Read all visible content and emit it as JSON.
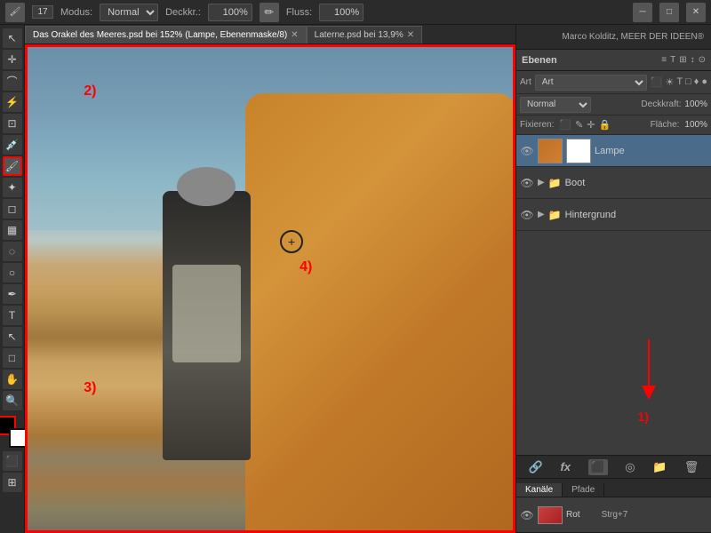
{
  "topbar": {
    "brush_size": "17",
    "modus_label": "Modus:",
    "modus_value": "Normal",
    "deckraft_label": "Deckkr.:",
    "deckraft_value": "100%",
    "fluss_label": "Fluss:",
    "fluss_value": "100%"
  },
  "tabs": [
    {
      "label": "Das Orakel des Meeres.psd bei 152% (Lampe, Ebenenmaske/8)",
      "active": true
    },
    {
      "label": "Laterne.psd bei 13,9%",
      "active": false
    }
  ],
  "layers_panel": {
    "title": "Ebenen",
    "filter_label": "Art",
    "blend_mode": "Normal",
    "opacity_label": "Deckkraft:",
    "opacity_value": "100%",
    "fix_label": "Fixieren:",
    "fill_label": "Fläche:",
    "fill_value": "100%",
    "layers": [
      {
        "name": "Lampe",
        "type": "layer_with_mask",
        "eye": true,
        "active": true
      },
      {
        "name": "Boot",
        "type": "folder",
        "eye": true,
        "active": false
      },
      {
        "name": "Hintergrund",
        "type": "folder",
        "eye": true,
        "active": false
      }
    ],
    "bottom_icons": [
      "link",
      "fx",
      "mask",
      "circle",
      "folder",
      "trash"
    ]
  },
  "channels_panel": {
    "tabs": [
      "Kanäle",
      "Pfade"
    ],
    "active_tab": "Kanäle",
    "channels": [
      {
        "name": "Rot",
        "shortcut": "Strg+7"
      }
    ]
  },
  "right_top": {
    "user": "Marco Kolditz, MEER DER IDEEN®"
  },
  "annotations": {
    "label_1": "1)",
    "label_2": "2)",
    "label_3": "3)",
    "label_4": "4)"
  },
  "color_fg": "#000000",
  "color_bg": "#ffffff"
}
